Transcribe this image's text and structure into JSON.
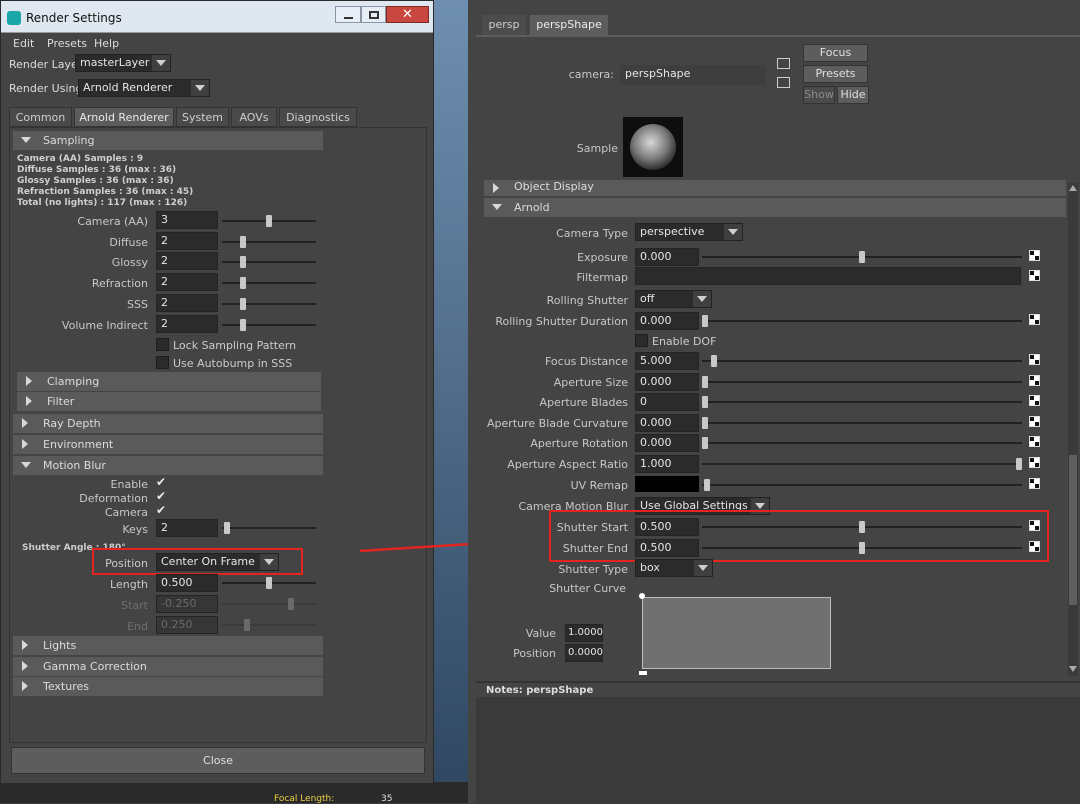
{
  "window": {
    "title": "Render Settings",
    "menu": [
      "Edit",
      "Presets",
      "Help"
    ],
    "render_layer_label": "Render Layer",
    "render_layer_value": "masterLayer",
    "render_using_label": "Render Using",
    "render_using_value": "Arnold Renderer",
    "tabs": [
      "Common",
      "Arnold Renderer",
      "System",
      "AOVs",
      "Diagnostics"
    ],
    "close_label": "Close"
  },
  "sampling": {
    "header": "Sampling",
    "stats": [
      "Camera (AA) Samples : 9",
      "Diffuse Samples : 36 (max : 36)",
      "Glossy Samples : 36 (max : 36)",
      "Refraction Samples : 36 (max : 45)",
      "Total (no lights) : 117 (max : 126)"
    ],
    "rows": [
      {
        "label": "Camera (AA)",
        "value": "3",
        "pos": 0.5
      },
      {
        "label": "Diffuse",
        "value": "2",
        "pos": 0.2
      },
      {
        "label": "Glossy",
        "value": "2",
        "pos": 0.2
      },
      {
        "label": "Refraction",
        "value": "2",
        "pos": 0.2
      },
      {
        "label": "SSS",
        "value": "2",
        "pos": 0.2
      },
      {
        "label": "Volume Indirect",
        "value": "2",
        "pos": 0.2
      }
    ],
    "lock_label": "Lock Sampling Pattern",
    "autobump_label": "Use Autobump in SSS"
  },
  "collapsed_top": [
    "Clamping",
    "Filter",
    "Ray Depth",
    "Environment"
  ],
  "motion_blur": {
    "header": "Motion Blur",
    "enable_label": "Enable",
    "deformation_label": "Deformation",
    "camera_label": "Camera",
    "keys_label": "Keys",
    "keys_value": "2",
    "shutter_angle": "Shutter Angle : 180°",
    "position_label": "Position",
    "position_value": "Center On Frame",
    "length_label": "Length",
    "length_value": "0.500",
    "start_label": "Start",
    "start_value": "-0.250",
    "end_label": "End",
    "end_value": "0.250"
  },
  "collapsed_bottom": [
    "Lights",
    "Gamma Correction",
    "Textures"
  ],
  "footer_text": {
    "focal_label": "Focal Length:",
    "focal_value": "35"
  },
  "attr": {
    "tabs": [
      "persp",
      "perspShape"
    ],
    "camera_label": "camera:",
    "camera_value": "perspShape",
    "focus_btn": "Focus",
    "presets_btn": "Presets",
    "show_btn": "Show",
    "hide_btn": "Hide",
    "sample_label": "Sample",
    "object_display": "Object Display",
    "arnold_header": "Arnold",
    "camera_type_label": "Camera Type",
    "camera_type_value": "perspective",
    "exposure_label": "Exposure",
    "exposure_value": "0.000",
    "filtermap_label": "Filtermap",
    "rolling_shutter_label": "Rolling Shutter",
    "rolling_shutter_value": "off",
    "rolling_dur_label": "Rolling Shutter Duration",
    "rolling_dur_value": "0.000",
    "enable_dof_label": "Enable DOF",
    "focus_distance_label": "Focus Distance",
    "focus_distance_value": "5.000",
    "aperture_size_label": "Aperture Size",
    "aperture_size_value": "0.000",
    "aperture_blades_label": "Aperture Blades",
    "aperture_blades_value": "0",
    "aperture_curv_label": "Aperture Blade Curvature",
    "aperture_curv_value": "0.000",
    "aperture_rot_label": "Aperture Rotation",
    "aperture_rot_value": "0.000",
    "aperture_ratio_label": "Aperture Aspect Ratio",
    "aperture_ratio_value": "1.000",
    "uv_remap_label": "UV Remap",
    "cam_mblur_label": "Camera Motion Blur",
    "cam_mblur_value": "Use Global Settings",
    "shutter_start_label": "Shutter Start",
    "shutter_start_value": "0.500",
    "shutter_end_label": "Shutter End",
    "shutter_end_value": "0.500",
    "shutter_type_label": "Shutter Type",
    "shutter_type_value": "box",
    "shutter_curve_label": "Shutter Curve",
    "value_label": "Value",
    "value_value": "1.0000",
    "position_label": "Position",
    "position_value": "0.0000",
    "notes_label": "Notes:  perspShape"
  },
  "colors": {
    "highlight": "#e0261f",
    "panel": "#444444"
  }
}
